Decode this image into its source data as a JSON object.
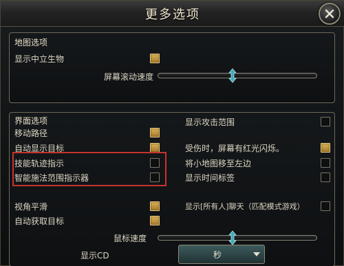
{
  "window": {
    "title": "更多选项"
  },
  "map_panel": {
    "title": "地图选项",
    "show_neutral_label": "显示中立生物",
    "show_neutral_checked": true,
    "scroll_speed_label": "屏幕滚动速度",
    "scroll_speed_value": 0.47
  },
  "ui_panel": {
    "title": "界面选项",
    "left_options": [
      {
        "label": "移动路径",
        "checked": true
      },
      {
        "label": "自动显示目标",
        "checked": true
      },
      {
        "label": "技能轨迹指示",
        "checked": false
      },
      {
        "label": "智能施法范围指示器",
        "checked": false
      }
    ],
    "right_options": [
      {
        "label": "显示攻击范围",
        "checked": false
      },
      {
        "label": "受伤时，屏幕有红光闪烁。",
        "checked": true
      },
      {
        "label": "将小地图移至左边",
        "checked": false
      },
      {
        "label": "显示时间标签",
        "checked": false
      }
    ],
    "lower_left": [
      {
        "label": "视角平滑",
        "checked": true
      },
      {
        "label": "自动获取目标",
        "checked": true
      }
    ],
    "all_chat_label": "显示[所有人]聊天（匹配模式游戏）",
    "all_chat_checked": false,
    "mouse_speed_label": "鼠标速度",
    "mouse_speed_value": 0.47,
    "cd_label": "显示CD",
    "cd_value": "秒"
  },
  "colors": {
    "checked": "#c89a40",
    "highlight": "#c6342c"
  }
}
